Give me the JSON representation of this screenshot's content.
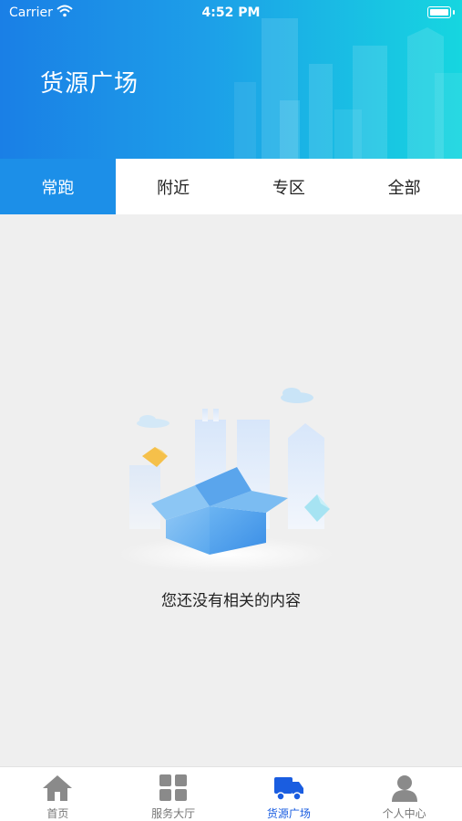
{
  "status_bar": {
    "carrier": "Carrier",
    "time": "4:52 PM"
  },
  "header": {
    "title": "货源广场"
  },
  "tabs": [
    {
      "label": "常跑",
      "active": true
    },
    {
      "label": "附近",
      "active": false
    },
    {
      "label": "专区",
      "active": false
    },
    {
      "label": "全部",
      "active": false
    }
  ],
  "empty_state": {
    "message": "您还没有相关的内容"
  },
  "tab_bar": {
    "items": [
      {
        "label": "首页",
        "icon": "home-icon"
      },
      {
        "label": "服务大厅",
        "icon": "grid-icon"
      },
      {
        "label": "货源广场",
        "icon": "truck-icon",
        "active": true
      },
      {
        "label": "个人中心",
        "icon": "person-icon"
      }
    ]
  },
  "colors": {
    "header_gradient_start": "#1a7fe6",
    "header_gradient_end": "#16d6e0",
    "active_tab": "#1c8fe8",
    "active_tabbar": "#1a5de0",
    "page_background": "#efefef"
  }
}
